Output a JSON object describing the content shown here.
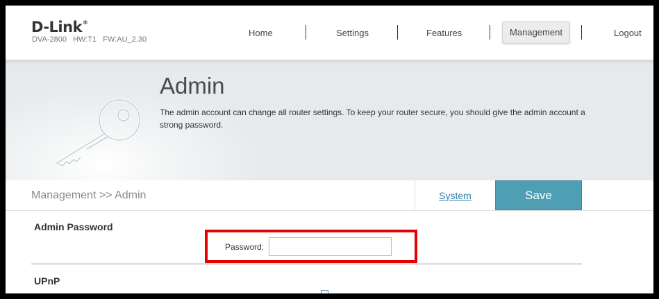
{
  "header": {
    "brand": "D-Link",
    "brand_mark": "®",
    "model": "DVA-2800   HW:T1   FW:AU_2.30"
  },
  "nav": {
    "home": "Home",
    "settings": "Settings",
    "features": "Features",
    "management": "Management",
    "logout": "Logout",
    "active": "Management"
  },
  "banner": {
    "icon": "key-icon",
    "title": "Admin",
    "description": "The admin account can change all router settings. To keep your router secure, you should give the admin account a strong password."
  },
  "toolbar": {
    "breadcrumb": "Management >> Admin",
    "system_link": "System",
    "save_label": "Save"
  },
  "admin_password": {
    "section_title": "Admin Password",
    "password_label": "Password:",
    "password_value": ""
  },
  "upnp": {
    "section_title": "UPnP"
  },
  "colors": {
    "accent": "#4e9fb3",
    "link": "#2f7fa6",
    "highlight": "#e60000"
  }
}
